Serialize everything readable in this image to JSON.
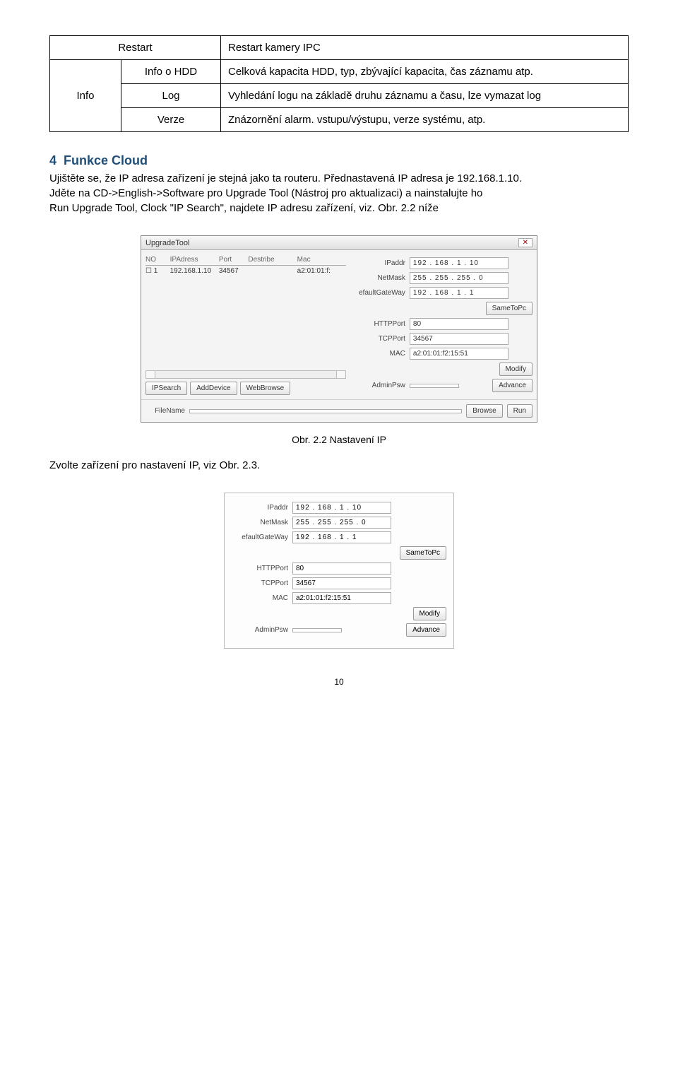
{
  "table": {
    "restart": {
      "label": "Restart",
      "desc": "Restart kamery IPC"
    },
    "info": {
      "group": "Info",
      "hdd": {
        "label": "Info o HDD",
        "desc": "Celková kapacita HDD, typ, zbývající kapacita, čas záznamu atp."
      },
      "log": {
        "label": "Log",
        "desc": "Vyhledání logu na základě druhu záznamu a času, lze vymazat log"
      },
      "verze": {
        "label": "Verze",
        "desc": "Znázornění alarm. vstupu/výstupu, verze systému, atp."
      }
    }
  },
  "section": {
    "num": "4",
    "title": "Funkce Cloud"
  },
  "para1": "Ujištěte se, že IP adresa zařízení je stejná jako ta routeru. Přednastavená IP adresa je 192.168.1.10.",
  "para2": "Jděte na CD->English->Software pro Upgrade Tool (Nástroj pro aktualizaci) a nainstalujte ho",
  "para3": "Run Upgrade Tool, Clock \"IP Search\", najdete IP adresu zařízení, viz. Obr. 2.2 níže",
  "fig1": {
    "title": "UpgradeTool",
    "close": "✕",
    "head": {
      "no": "NO",
      "ip": "IPAdress",
      "port": "Port",
      "desc": "Destribe",
      "mac": "Mac"
    },
    "row": {
      "no": "1",
      "ip": "192.168.1.10",
      "port": "34567",
      "desc": "",
      "mac": "a2:01:01:f:"
    },
    "labels": {
      "ipaddr": "IPaddr",
      "netmask": "NetMask",
      "gateway": "efaultGateWay",
      "sametopc": "SameToPc",
      "httpport": "HTTPPort",
      "tcpport": "TCPPort",
      "mac": "MAC",
      "modify": "Modify",
      "adminpsw": "AdminPsw",
      "advance": "Advance"
    },
    "values": {
      "ipaddr": "192 . 168 .   1  .  10",
      "netmask": "255 . 255 . 255 .   0",
      "gateway": "192 . 168 .   1  .   1",
      "httpport": "80",
      "tcpport": "34567",
      "mac": "a2:01:01:f2:15:51"
    },
    "buttons": {
      "ipsearch": "IPSearch",
      "adddevice": "AddDevice",
      "webbrowse": "WebBrowse",
      "filename": "FileName",
      "browse": "Browse",
      "run": "Run"
    }
  },
  "caption1": "Obr. 2.2 Nastavení IP",
  "para4": "Zvolte zařízení pro nastavení IP, viz Obr. 2.3.",
  "fig2": {
    "labels": {
      "ipaddr": "IPaddr",
      "netmask": "NetMask",
      "gateway": "efaultGateWay",
      "sametopc": "SameToPc",
      "httpport": "HTTPPort",
      "tcpport": "TCPPort",
      "mac": "MAC",
      "modify": "Modify",
      "adminpsw": "AdminPsw",
      "advance": "Advance"
    },
    "values": {
      "ipaddr": "192 . 168 .   1  .  10",
      "netmask": "255 . 255 . 255 .   0",
      "gateway": "192 . 168 .   1  .   1",
      "httpport": "80",
      "tcpport": "34567",
      "mac": "a2:01:01:f2:15:51"
    }
  },
  "page_num": "10"
}
